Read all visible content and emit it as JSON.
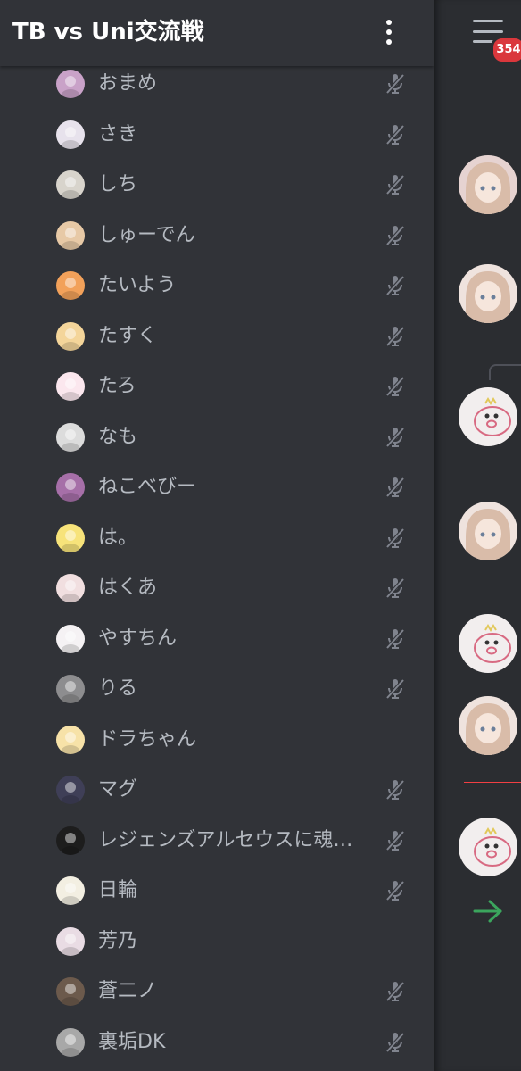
{
  "header": {
    "title": "TB vs Uni交流戦",
    "more_icon": "vertical-ellipsis-icon"
  },
  "members": [
    {
      "name": "おまめ",
      "muted": true,
      "avatar_color": "#c9a2c8"
    },
    {
      "name": "さき",
      "muted": true,
      "avatar_color": "#e7e2ec"
    },
    {
      "name": "しち",
      "muted": true,
      "avatar_color": "#d8d4cc"
    },
    {
      "name": "しゅーでん",
      "muted": true,
      "avatar_color": "#e7c9a6"
    },
    {
      "name": "たいよう",
      "muted": true,
      "avatar_color": "#f2a15a"
    },
    {
      "name": "たすく",
      "muted": true,
      "avatar_color": "#f4d59a"
    },
    {
      "name": "たろ",
      "muted": true,
      "avatar_color": "#fbe7ee"
    },
    {
      "name": "なも",
      "muted": true,
      "avatar_color": "#dcdcdc"
    },
    {
      "name": "ねこべびー",
      "muted": true,
      "avatar_color": "#a66fa8"
    },
    {
      "name": "は。",
      "muted": true,
      "avatar_color": "#f7e37a"
    },
    {
      "name": "はくあ",
      "muted": true,
      "avatar_color": "#f1dfe0"
    },
    {
      "name": "やすちん",
      "muted": true,
      "avatar_color": "#f5f2f4"
    },
    {
      "name": "りる",
      "muted": true,
      "avatar_color": "#8d8d8f"
    },
    {
      "name": "ドラちゃん",
      "muted": false,
      "avatar_color": "#f7e2a8"
    },
    {
      "name": "マグ",
      "muted": true,
      "avatar_color": "#3f3f57"
    },
    {
      "name": "レジェンズアルセウスに魂…",
      "muted": true,
      "avatar_color": "#1d1d1d"
    },
    {
      "name": "日輪",
      "muted": true,
      "avatar_color": "#f3efe2"
    },
    {
      "name": "芳乃",
      "muted": false,
      "avatar_color": "#e9dce4"
    },
    {
      "name": "蒼二ノ",
      "muted": true,
      "avatar_color": "#6c5a4c"
    },
    {
      "name": "裏垢DK",
      "muted": true,
      "avatar_color": "#a8a8a8"
    }
  ],
  "chat": {
    "menu_icon": "hamburger-menu-icon",
    "unread_badge": "354",
    "avatars": [
      {
        "name": "avatar-girl",
        "color": "#e6d3d1"
      },
      {
        "name": "avatar-anime",
        "color": "#efe3de"
      },
      {
        "name": "avatar-pig",
        "color": "#f2eeee"
      },
      {
        "name": "avatar-anime",
        "color": "#efe3de"
      },
      {
        "name": "avatar-pig",
        "color": "#f2eeee"
      },
      {
        "name": "avatar-anime",
        "color": "#efe3de"
      },
      {
        "name": "avatar-pig",
        "color": "#f2eeee"
      }
    ],
    "join_icon": "arrow-right-icon",
    "colors": {
      "new_divider": "#f23f43",
      "join_arrow": "#3ba55d"
    }
  },
  "colors": {
    "drawer_bg": "#313338",
    "chat_bg": "#2b2d31",
    "text_primary": "#ffffff",
    "text_secondary": "#b5bac1",
    "badge": "#da373c"
  }
}
